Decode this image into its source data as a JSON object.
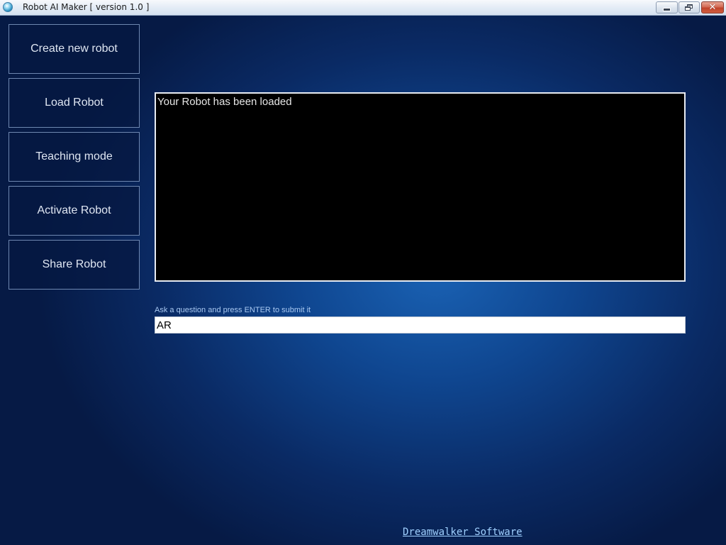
{
  "window": {
    "title": "Robot AI Maker [ version 1.0 ]",
    "icon": "robot-ai-app-icon",
    "close_glyph": "✕"
  },
  "sidebar": {
    "items": [
      {
        "label": "Create new robot"
      },
      {
        "label": "Load Robot"
      },
      {
        "label": "Teaching mode"
      },
      {
        "label": "Activate Robot"
      },
      {
        "label": "Share Robot"
      }
    ]
  },
  "output": {
    "text": "Your Robot has been loaded"
  },
  "question": {
    "label": "Ask a question and press ENTER to submit it",
    "value": "AR"
  },
  "footer": {
    "link_text": "Dreamwalker Software"
  },
  "colors": {
    "background": "#0f4690",
    "output_bg": "#000000",
    "label_accent": "#a9c9f2",
    "link": "#9fd0ff"
  }
}
